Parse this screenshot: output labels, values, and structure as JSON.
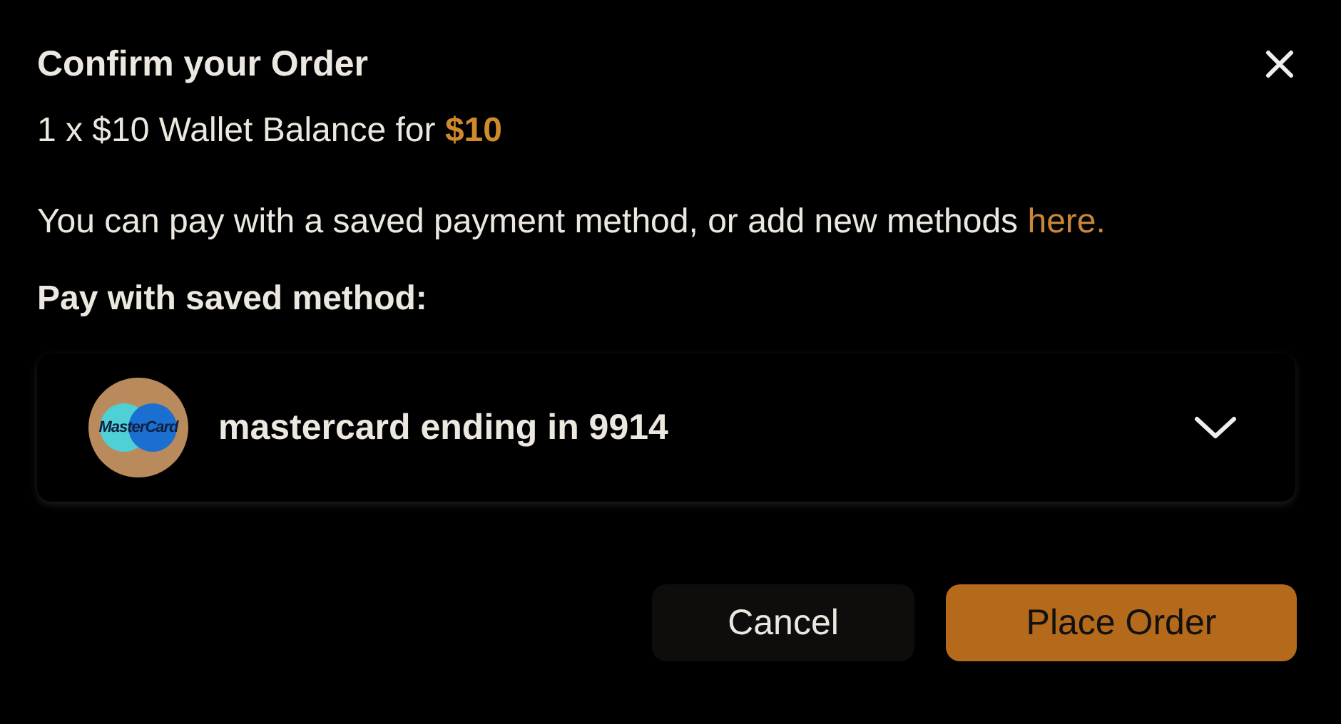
{
  "dialog": {
    "title": "Confirm your Order",
    "summary": {
      "text": "1 x $10 Wallet Balance for",
      "price": "$10"
    },
    "note": {
      "text": "You can pay with a saved payment method, or add new methods",
      "link": "here."
    },
    "section_label": "Pay with saved method:",
    "payment_method": {
      "logo_text": "MasterCard",
      "label": "mastercard ending in 9914",
      "expanded": false
    },
    "buttons": [
      {
        "label": "Cancel",
        "kind": "secondary"
      },
      {
        "label": "Place Order",
        "kind": "primary"
      }
    ]
  }
}
